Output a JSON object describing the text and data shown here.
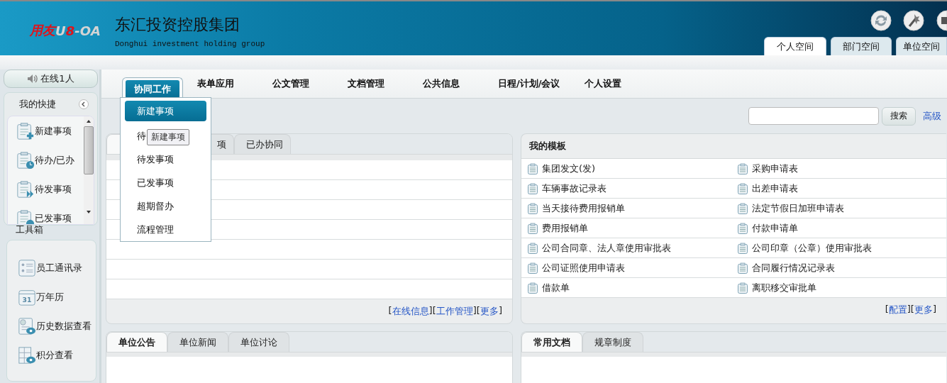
{
  "logo": {
    "brand": "用友",
    "product_prefix": "U",
    "product_number": "8",
    "product_suffix": "-OA"
  },
  "company": {
    "name": "东汇投资控股集团",
    "subtitle": "Donghui investment holding group"
  },
  "space_tabs": [
    {
      "label": "个人空间",
      "selected": true
    },
    {
      "label": "部门空间",
      "selected": false
    },
    {
      "label": "单位空间",
      "selected": false
    }
  ],
  "online": "在线1人",
  "shortcuts": {
    "title": "我的快捷",
    "items": [
      {
        "label": "新建事项",
        "kind": "new"
      },
      {
        "label": "待办/已办",
        "kind": "pending"
      },
      {
        "label": "待发事项",
        "kind": "draft"
      },
      {
        "label": "已发事项",
        "kind": "sent"
      }
    ]
  },
  "toolbox": {
    "title": "工具箱",
    "items": [
      {
        "label": "员工通讯录",
        "kind": "contacts"
      },
      {
        "label": "万年历",
        "kind": "calendar",
        "icon_text": "31"
      },
      {
        "label": "历史数据查看",
        "kind": "history"
      },
      {
        "label": "积分查看",
        "kind": "points"
      }
    ]
  },
  "nav": [
    {
      "label": "协同工作",
      "selected": true
    },
    {
      "label": "表单应用",
      "selected": false
    },
    {
      "label": "公文管理",
      "selected": false
    },
    {
      "label": "文档管理",
      "selected": false
    },
    {
      "label": "公共信息",
      "selected": false
    },
    {
      "label": "日程/计划/会议",
      "selected": false
    },
    {
      "label": "个人设置",
      "selected": false
    }
  ],
  "dropdown": {
    "items": [
      {
        "label": "新建事项",
        "selected": true
      },
      {
        "label": "待",
        "selected": false
      },
      {
        "label": "待发事项",
        "selected": false
      },
      {
        "label": "已发事项",
        "selected": false
      },
      {
        "label": "超期督办",
        "selected": false
      },
      {
        "label": "流程管理",
        "selected": false
      }
    ],
    "tooltip": "新建事项"
  },
  "search": {
    "button": "搜索",
    "advanced": "高级"
  },
  "work_panel": {
    "tabs": [
      {
        "selected": true
      },
      {
        "label": "项",
        "selected": false
      },
      {
        "label": "已办协同",
        "selected": false
      }
    ],
    "links": [
      {
        "open": "[",
        "label": "在线信息",
        "close": "]"
      },
      {
        "open": "[",
        "label": "工作管理",
        "close": "]"
      },
      {
        "open": "[",
        "label": "更多",
        "close": "]"
      }
    ]
  },
  "templates": {
    "title": "我的模板",
    "items": [
      "集团发文(发)",
      "采购申请表",
      "车辆事故记录表",
      "出差申请表",
      "当天接待费用报销单",
      "法定节假日加班申请表",
      "费用报销单",
      "付款申请单",
      "公司合同章、法人章使用审批表",
      "公司印章（公章）使用审批表",
      "公司证照使用申请表",
      "合同履行情况记录表",
      "借款单",
      "离职移交审批单"
    ],
    "links": [
      {
        "open": "[",
        "label": "配置",
        "close": "]"
      },
      {
        "open": "[",
        "label": "更多",
        "close": "]"
      }
    ]
  },
  "notice_panel": {
    "tabs": [
      {
        "label": "单位公告",
        "selected": true
      },
      {
        "label": "单位新闻",
        "selected": false
      },
      {
        "label": "单位讨论",
        "selected": false
      }
    ]
  },
  "docs_panel": {
    "tabs": [
      {
        "label": "常用文档",
        "selected": true
      },
      {
        "label": "规章制度",
        "selected": false
      }
    ]
  }
}
